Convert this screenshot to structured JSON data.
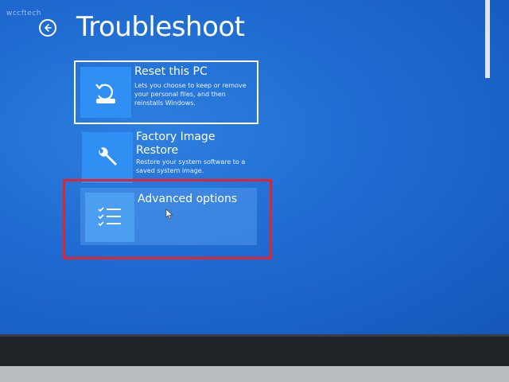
{
  "watermark": "wccftech",
  "header": {
    "title": "Troubleshoot",
    "back_icon": "back-arrow-icon"
  },
  "options": [
    {
      "title": "Reset this PC",
      "description": "Lets you choose to keep or remove your personal files, and then reinstalls Windows.",
      "icon": "reset-icon"
    },
    {
      "title": "Factory Image Restore",
      "description": "Restore your system software to a saved system image.",
      "icon": "wrench-icon"
    },
    {
      "title": "Advanced options",
      "description": "",
      "icon": "checklist-icon"
    }
  ],
  "colors": {
    "background": "#1f6bd1",
    "tile": "#2f8ff2",
    "highlight": "#e3232e",
    "text": "#ffffff"
  }
}
